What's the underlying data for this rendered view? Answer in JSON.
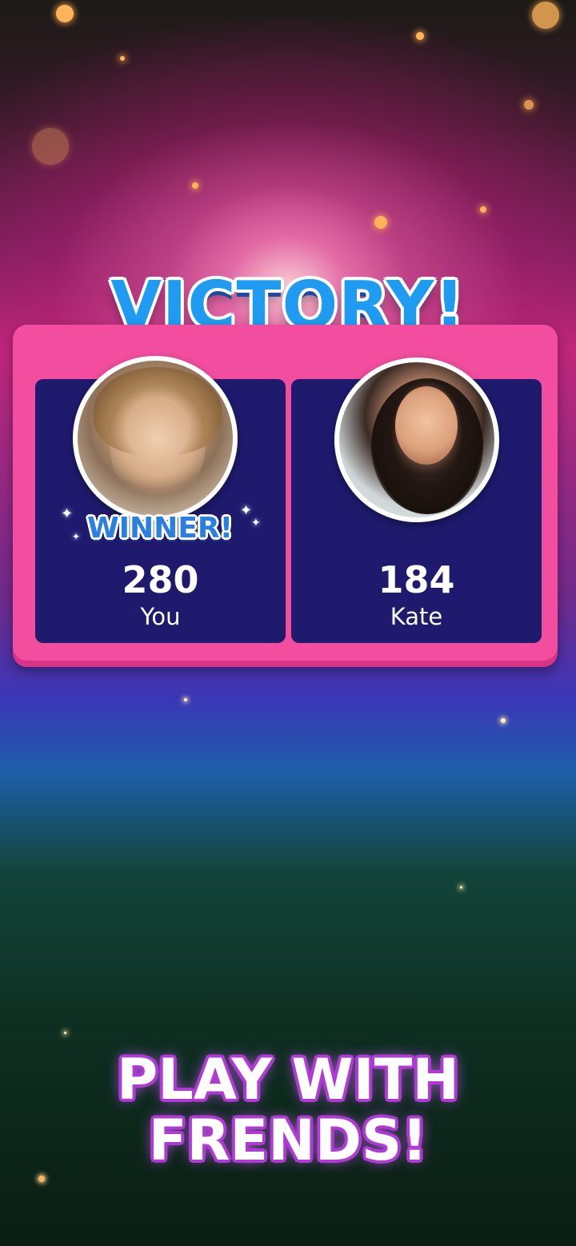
{
  "title": "VICTORY!",
  "players": [
    {
      "name": "You",
      "score": "280",
      "badge": "WINNER!",
      "avatar": "woman-short-blonde-hair-avatar"
    },
    {
      "name": "Kate",
      "score": "184",
      "avatar": "woman-dark-hair-smiling-avatar"
    }
  ],
  "promo": {
    "line1": "PLAY WITH",
    "line2": "FRENDS!"
  },
  "colors": {
    "panel": "#f24d9e",
    "card": "#1f1a6e",
    "title": "#1f9cf1",
    "promo_outline": "#b03ad6"
  }
}
